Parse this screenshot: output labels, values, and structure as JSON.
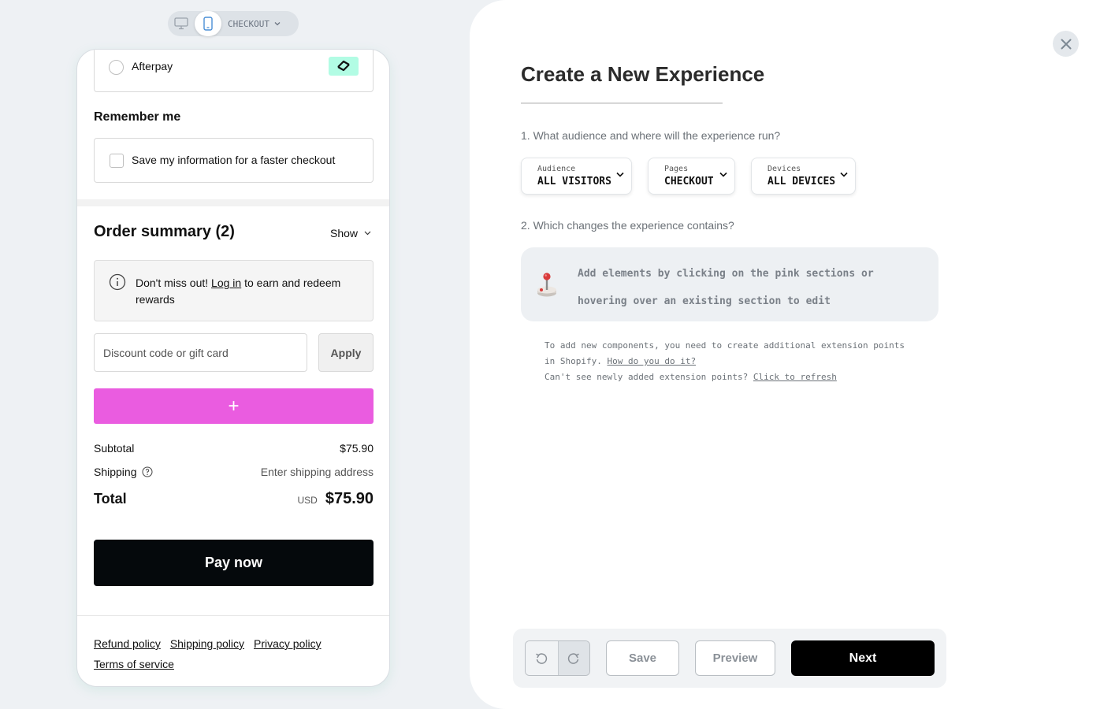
{
  "preview": {
    "page_selector": "CHECKOUT",
    "afterpay": {
      "label": "Afterpay"
    },
    "remember": {
      "title": "Remember me",
      "checkbox_label": "Save my information for a faster checkout"
    },
    "order_summary": {
      "title": "Order summary (2)",
      "toggle_label": "Show"
    },
    "rewards": {
      "prefix": "Don't miss out! ",
      "link": "Log in",
      "suffix": " to earn and redeem rewards"
    },
    "discount": {
      "placeholder": "Discount code or gift card",
      "apply_label": "Apply"
    },
    "add_section_label": "+",
    "totals": {
      "subtotal_label": "Subtotal",
      "subtotal_value": "$75.90",
      "shipping_label": "Shipping",
      "shipping_value": "Enter shipping address",
      "total_label": "Total",
      "total_currency": "USD",
      "total_value": "$75.90"
    },
    "pay_label": "Pay now",
    "policies": [
      "Refund policy",
      "Shipping policy",
      "Privacy policy",
      "Terms of service"
    ]
  },
  "panel": {
    "title": "Create a New Experience",
    "question_1": "1. What audience and where will the experience run?",
    "dropdowns": {
      "audience": {
        "label": "Audience",
        "value": "ALL VISITORS"
      },
      "pages": {
        "label": "Pages",
        "value": "CHECKOUT"
      },
      "devices": {
        "label": "Devices",
        "value": "ALL DEVICES"
      }
    },
    "question_2": "2. Which changes the experience contains?",
    "hint": "Add elements by clicking on the pink sections or hovering over an existing section to edit",
    "note": {
      "line1": "To add new components, you need to create additional extension points in Shopify. ",
      "link1": "How do you do it?",
      "line2": "Can't see newly added extension points? ",
      "link2": "Click to refresh"
    },
    "actions": {
      "save": "Save",
      "preview": "Preview",
      "next": "Next"
    }
  },
  "colors": {
    "accent_pink": "#ea5ce0",
    "afterpay_mint": "#b2fce4",
    "primary_black": "#05090c"
  }
}
